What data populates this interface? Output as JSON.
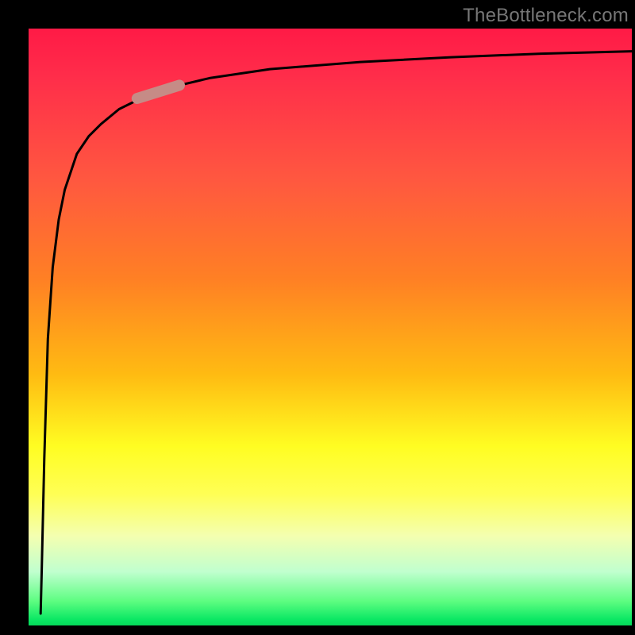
{
  "watermark": "TheBottleneck.com",
  "chart_data": {
    "type": "line",
    "title": "",
    "xlabel": "",
    "ylabel": "",
    "xlim": [
      0,
      100
    ],
    "ylim": [
      0,
      100
    ],
    "x": [
      2.0,
      2.2,
      2.6,
      3.2,
      4.0,
      5,
      6,
      8,
      10,
      12,
      15,
      20,
      25,
      30,
      40,
      55,
      70,
      85,
      100
    ],
    "values": [
      2,
      10,
      28,
      48,
      60,
      68,
      73,
      79,
      82,
      84,
      86.5,
      89,
      90.5,
      91.7,
      93.2,
      94.4,
      95.2,
      95.8,
      96.2
    ],
    "marker": {
      "x_start": 18,
      "x_end": 25,
      "y_start": 88.3,
      "y_end": 90.5
    },
    "colors": {
      "curve": "#000000",
      "marker": "#c68b86"
    }
  }
}
